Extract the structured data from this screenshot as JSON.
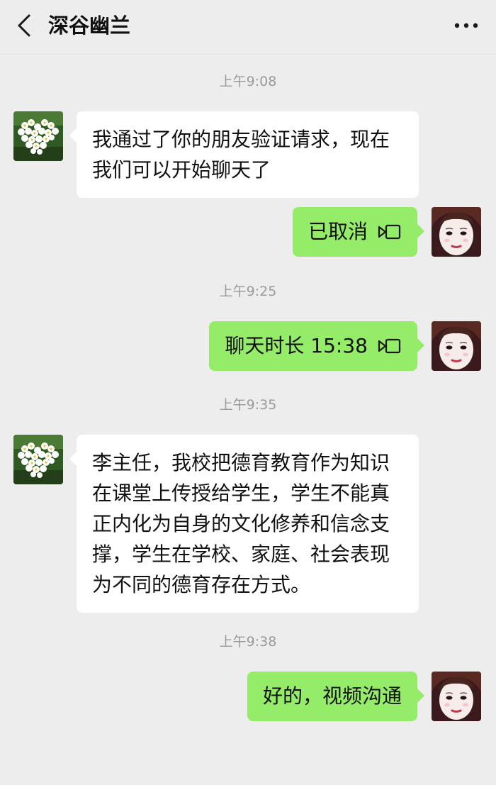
{
  "header": {
    "title": "深谷幽兰",
    "back_icon": "chevron-left-icon",
    "more_icon": "more-dots-icon"
  },
  "messages": [
    {
      "type": "timestamp",
      "text": "上午9:08"
    },
    {
      "type": "text",
      "from": "contact",
      "text": "我通过了你的朋友验证请求，现在我们可以开始聊天了"
    },
    {
      "type": "call",
      "from": "me",
      "text": "已取消",
      "icon": "video-call-icon"
    },
    {
      "type": "timestamp",
      "text": "上午9:25"
    },
    {
      "type": "call",
      "from": "me",
      "text": "聊天时长 15:38",
      "icon": "video-call-icon"
    },
    {
      "type": "timestamp",
      "text": "上午9:35"
    },
    {
      "type": "text",
      "from": "contact",
      "text": "李主任，我校把德育教育作为知识在课堂上传授给学生，学生不能真正内化为自身的文化修养和信念支撑，学生在学校、家庭、社会表现为不同的德育存在方式。"
    },
    {
      "type": "timestamp",
      "text": "上午9:38"
    },
    {
      "type": "text",
      "from": "me",
      "text": "好的，视频沟通"
    }
  ],
  "colors": {
    "background": "#ededed",
    "incoming_bubble": "#ffffff",
    "outgoing_bubble": "#95ec69",
    "timestamp_text": "#9a9a9a"
  }
}
